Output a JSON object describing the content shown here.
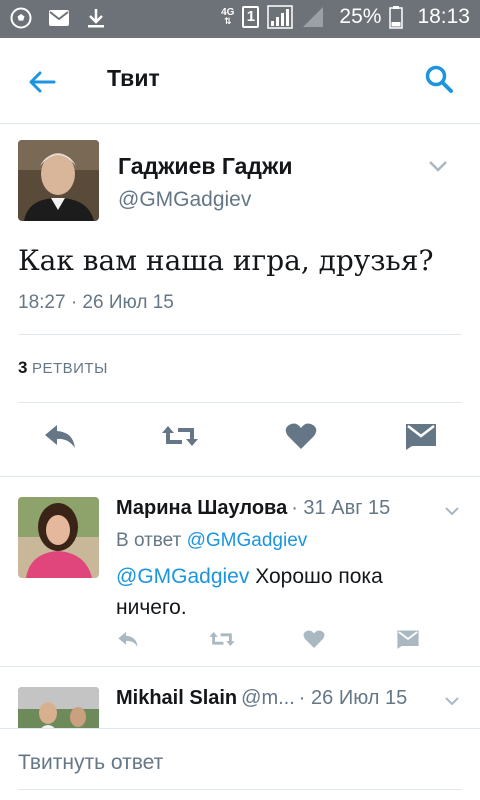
{
  "status_bar": {
    "network": "4G",
    "sim": "1",
    "battery": "25%",
    "time": "18:13"
  },
  "header": {
    "title": "Твит"
  },
  "tweet": {
    "author_name": "Гаджиев Гаджи",
    "author_handle": "@GMGadgiev",
    "text": "Как вам наша игра, друзья?",
    "meta": "18:27 · 26 Июл 15",
    "retweet_count": "3",
    "retweet_label": "РЕТВИТЫ"
  },
  "replies": [
    {
      "name": "Марина Шаулова",
      "date": "· 31 Авг 15",
      "in_reply_prefix": "В ответ",
      "in_reply_handle": "@GMGadgiev",
      "mention": "@GMGadgiev",
      "text": " Хорошо пока ничего."
    },
    {
      "name": "Mikhail Slain",
      "handle_short": "@m...",
      "date": "· 26 Июл 15"
    }
  ],
  "compose": {
    "placeholder": "Твитнуть ответ"
  },
  "colors": {
    "accent": "#1b95e0",
    "muted": "#657786",
    "statusbar": "#6d7278"
  }
}
